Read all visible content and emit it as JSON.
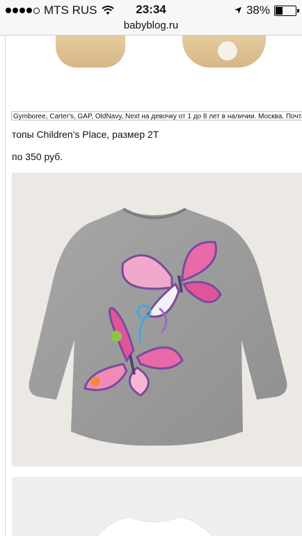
{
  "status_bar": {
    "carrier": "MTS RUS",
    "time": "23:34",
    "battery": "38%",
    "battery_level": 0.38,
    "icons": [
      "signal-dots-icon",
      "wifi-icon",
      "location-arrow-icon",
      "battery-icon"
    ]
  },
  "browser": {
    "url": "babyblog.ru"
  },
  "post": {
    "ticker": "Gymboree, Carter's, GAP, OldNavy, Next на девочку от 1 до 8 лет в наличии.  Москва. Почта",
    "title": "топы Children's Place, размер 2T",
    "price": "по 350 руб."
  },
  "colors": {
    "shirt": "#9b9b9b",
    "butterfly_pink": "#e0559a",
    "accent_purple": "#7a4a9c",
    "photo_bg": "#ece9e4"
  }
}
